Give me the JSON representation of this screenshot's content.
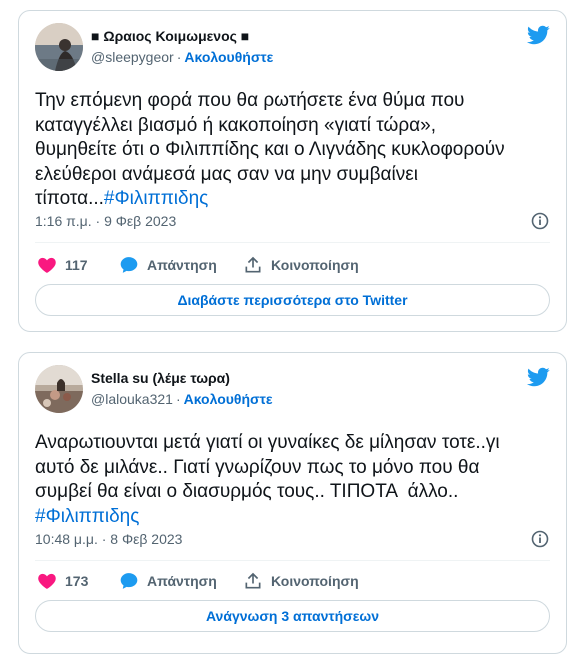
{
  "colors": {
    "link": "#006fd6",
    "twitter_blue": "#1d9bf0",
    "heart": "#f91880",
    "muted": "#536471",
    "border": "#cfd9de"
  },
  "tweets": [
    {
      "display_name": "■ Ωραιος Κοιμωμενος ■",
      "handle": "@sleepygeor",
      "separator": "·",
      "follow_label": "Ακολουθήστε",
      "text_lines": [
        "Την επόμενη φορά που θα ρωτήσετε ένα θύμα που",
        "καταγγέλλει βιασμό ή κακοποίηση «γιατί τώρα»,",
        "θυμηθείτε ότι ο Φιλιππίδης και ο Λιγνάδης κυκλοφορούν",
        "ελεύθεροι ανάμεσά μας σαν να μην συμβαίνει",
        "τίποτα..."
      ],
      "hashtag": "#Φιλιππιδης",
      "timestamp": "1:16 π.μ. · 9 Φεβ 2023",
      "likes": "117",
      "reply_label": "Απάντηση",
      "share_label": "Κοινοποίηση",
      "more_label": "Διαβάστε περισσότερα στο Twitter",
      "icons": {
        "bird": "twitter-bird-icon",
        "info": "info-icon",
        "like": "heart-icon",
        "reply": "speech-bubble-icon",
        "share": "upload-icon"
      }
    },
    {
      "display_name": "Stella su (λέμε τωρα)",
      "handle": "@lalouka321",
      "separator": "·",
      "follow_label": "Ακολουθήστε",
      "text_lines": [
        "Αναρωτιουνται μετά γιατί οι γυναίκες δε μίλησαν τοτε..γι",
        "αυτό δε μιλάνε.. Γιατί γνωρίζουν πως το μόνο που θα",
        "συμβεί θα είναι ο διασυρμός τους.. ΤΙΠΟΤΑ  άλλο.."
      ],
      "hashtag": "#Φιλιππιδης",
      "timestamp": "10:48 μ.μ. · 8 Φεβ 2023",
      "likes": "173",
      "reply_label": "Απάντηση",
      "share_label": "Κοινοποίηση",
      "more_label": "Ανάγνωση 3 απαντήσεων",
      "icons": {
        "bird": "twitter-bird-icon",
        "info": "info-icon",
        "like": "heart-icon",
        "reply": "speech-bubble-icon",
        "share": "upload-icon"
      }
    }
  ]
}
